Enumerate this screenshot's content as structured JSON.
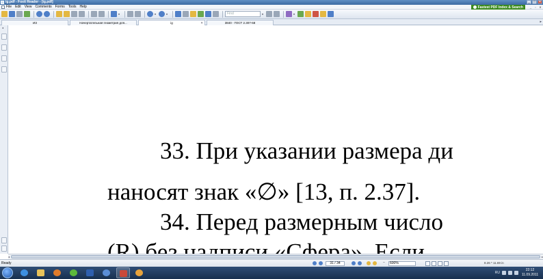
{
  "window": {
    "title": "ig.pdf - Foxit Reader - [ig.pdf]"
  },
  "menu": {
    "items": [
      "File",
      "Edit",
      "View",
      "Comments",
      "Forms",
      "Tools",
      "Help"
    ],
    "banner_text": "Fastest PDF Index & Search",
    "mdi_buttons": [
      "_",
      "▫",
      "✕"
    ]
  },
  "toolbar": {
    "search_placeholder": "Find"
  },
  "tabs": [
    {
      "label": "ИЗ"
    },
    {
      "label": "Начертательная геометрия для..."
    },
    {
      "label": "ig"
    },
    {
      "label": "3840 - ГОСТ 2.307-68"
    }
  ],
  "document": {
    "lines": [
      "33. При указании размера ди",
      "наносят знак «∅» [13, п. 2.37].",
      "34. Перед размерным число",
      "(R) без надписи «Сфера». Если"
    ]
  },
  "status": {
    "ready": "Ready",
    "page_indicator": "31 / 34",
    "zoom": "600%",
    "page_size": "8.26 * 11.69 in"
  },
  "taskbar": {
    "lang": "RU",
    "time": "22:12",
    "date": "11.09.2011"
  }
}
